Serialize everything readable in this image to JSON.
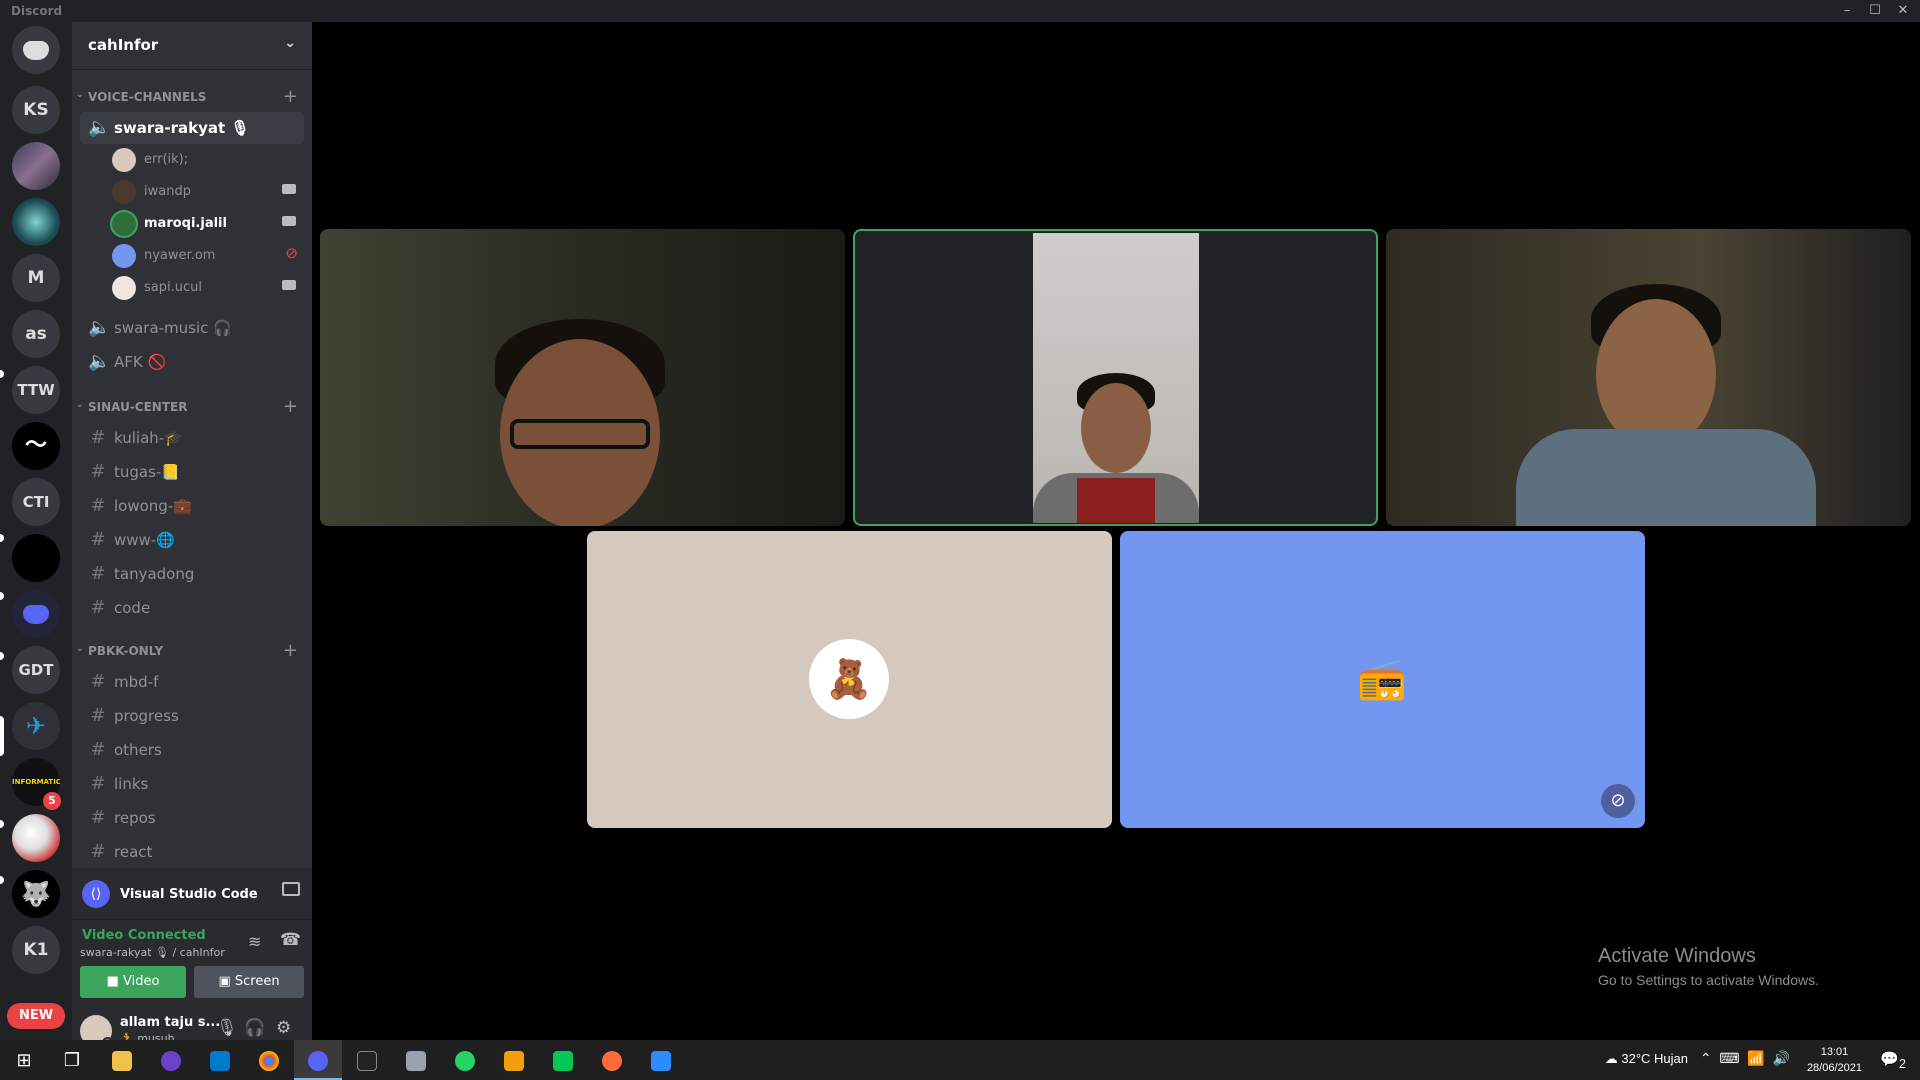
{
  "window": {
    "title": "Discord",
    "controls": [
      "–",
      "☐",
      "✕"
    ]
  },
  "rail": {
    "servers": [
      {
        "label": "",
        "icon": "discord-icon"
      },
      {
        "label": "KS"
      },
      {
        "label": ""
      },
      {
        "label": ""
      },
      {
        "label": "M"
      },
      {
        "label": "as"
      },
      {
        "label": "TTW"
      },
      {
        "label": ""
      },
      {
        "label": "CTI"
      },
      {
        "label": ""
      },
      {
        "label": ""
      },
      {
        "label": "GDT"
      },
      {
        "label": ""
      },
      {
        "label": "INFORMATIC"
      },
      {
        "label": ""
      },
      {
        "label": ""
      },
      {
        "label": "K1"
      }
    ],
    "badge_count": "5",
    "new_label": "NEW"
  },
  "guild": {
    "name": "cahInfor"
  },
  "categories": {
    "voice": "VOICE-CHANNELS",
    "sinau": "SINAU-CENTER",
    "pbkk": "PBKK-ONLY"
  },
  "voice_channels": [
    {
      "name": "swara-rakyat 🎙"
    },
    {
      "name": "swara-music 🎧"
    },
    {
      "name": "AFK 🚫"
    }
  ],
  "voice_users": [
    {
      "name": "err(ik);",
      "video": "none"
    },
    {
      "name": "iwandp",
      "video": "on"
    },
    {
      "name": "maroqi.jalil",
      "video": "on"
    },
    {
      "name": "nyawer.om",
      "video": "off"
    },
    {
      "name": "sapi.ucul",
      "video": "on"
    }
  ],
  "sinau_channels": [
    "kuliah-🎓",
    "tugas-📒",
    "lowong-💼",
    "www-🌐",
    "tanyadong",
    "code"
  ],
  "pbkk_channels": [
    "mbd-f",
    "progress",
    "others",
    "links",
    "repos",
    "react"
  ],
  "activity": {
    "name": "Visual Studio Code"
  },
  "voice_status": {
    "status": "Video Connected",
    "location": "swara-rakyat 🎙 / cahInfor",
    "video_label": "Video",
    "screen_label": "Screen"
  },
  "user": {
    "name": "allam taju s...",
    "status": "🏃 musuh ..."
  },
  "watermark": {
    "line1": "Activate Windows",
    "line2": "Go to Settings to activate Windows."
  },
  "taskbar": {
    "weather": "32°C  Hujan",
    "time": "13:01",
    "date": "28/06/2021",
    "notif_count": "2"
  },
  "colors": {
    "accent": "#5865f2",
    "online": "#3ba55d",
    "danger": "#ed4245"
  }
}
